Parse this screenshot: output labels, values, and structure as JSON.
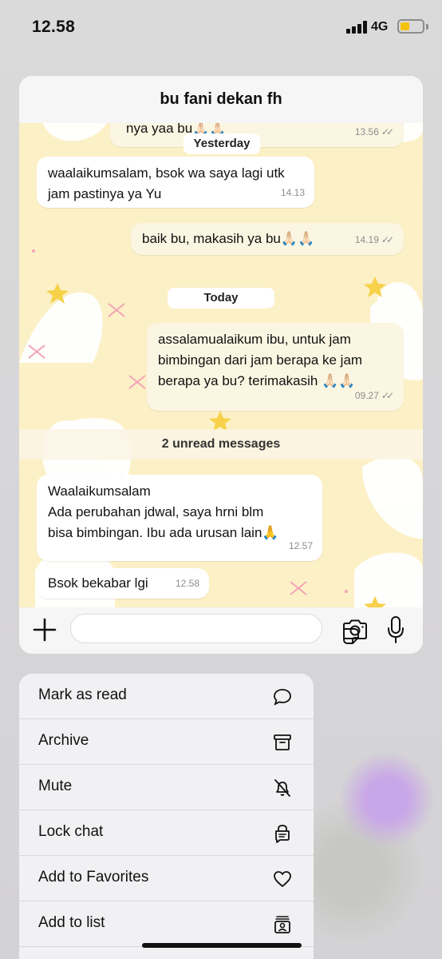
{
  "status_bar": {
    "time": "12.58",
    "network": "4G",
    "battery_color": "#f4c20d"
  },
  "chat": {
    "title": "bu fani dekan fh",
    "messages": [
      {
        "direction": "out",
        "text": "nya yaa bu🙏🏻🙏🏻",
        "time": "13.56",
        "read": true
      },
      {
        "direction": "in",
        "text": "waalaikumsalam, bsok wa saya lagi utk\njam pastinya ya Yu",
        "time": "14.13"
      },
      {
        "direction": "out",
        "text": "baik bu, makasih ya bu🙏🏻🙏🏻",
        "time": "14.19",
        "read": true
      },
      {
        "direction": "out",
        "text": "assalamualaikum ibu, untuk jam\nbimbingan dari jam berapa ke jam\nberapa ya bu? terimakasih 🙏🏻🙏🏻",
        "time": "09.27",
        "read": true
      },
      {
        "direction": "in",
        "text": "Waalaikumsalam\nAda perubahan jdwal,  saya hrni blm\nbisa bimbingan. Ibu ada urusan lain🙏",
        "time": "12.57"
      },
      {
        "direction": "in",
        "text": "Bsok bekabar lgi",
        "time": "12.58"
      }
    ],
    "date_separators": [
      "Yesterday",
      "Today"
    ],
    "unread_banner": "2 unread messages",
    "input_placeholder": "",
    "accent_colors": {
      "wallpaper": "#fcf0c6",
      "incoming_bubble": "#ffffff",
      "outgoing_bubble": "#fbf6e2"
    }
  },
  "context_menu": {
    "items": [
      {
        "label": "Mark as read",
        "icon": "chat-bubble-icon"
      },
      {
        "label": "Archive",
        "icon": "archive-box-icon"
      },
      {
        "label": "Mute",
        "icon": "bell-slash-icon"
      },
      {
        "label": "Lock chat",
        "icon": "lock-chat-icon"
      },
      {
        "label": "Add to Favorites",
        "icon": "heart-icon"
      },
      {
        "label": "Add to list",
        "icon": "contact-list-icon"
      }
    ]
  }
}
